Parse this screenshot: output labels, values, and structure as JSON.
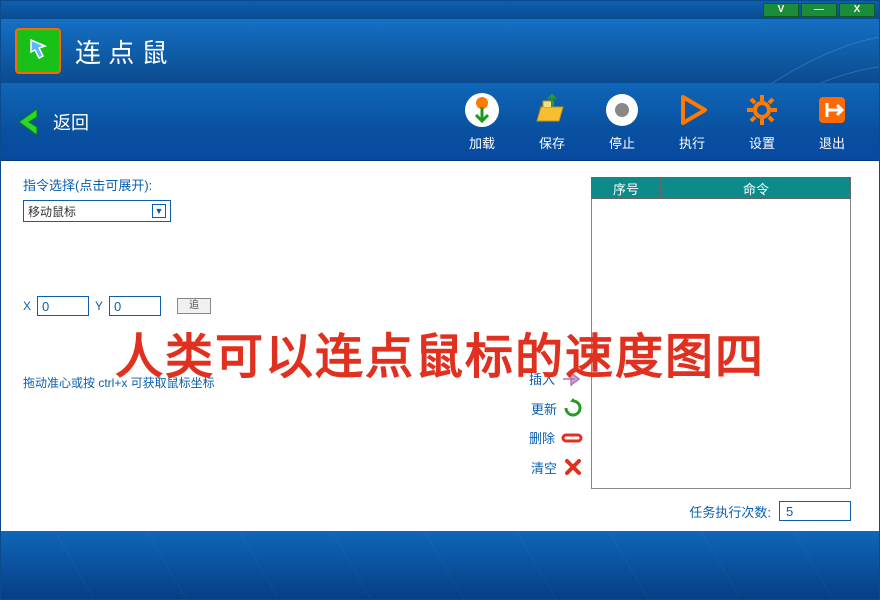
{
  "app": {
    "title": "连 点 鼠"
  },
  "window_controls": {
    "v": "V",
    "min": "—",
    "close": "X"
  },
  "back": {
    "label": "返回"
  },
  "toolbar": {
    "load": "加载",
    "save": "保存",
    "stop": "停止",
    "run": "执行",
    "settings": "设置",
    "exit": "退出"
  },
  "left": {
    "section_label": "指令选择(点击可展开):",
    "combo_value": "移动鼠标",
    "x_label": "X",
    "y_label": "Y",
    "x_value": "0",
    "y_value": "0",
    "track_btn": "追",
    "hint": "拖动准心或按 ctrl+x 可获取鼠标坐标"
  },
  "grid": {
    "col_seq": "序号",
    "col_cmd": "命令"
  },
  "actions": {
    "insert": "插入",
    "update": "更新",
    "delete": "删除",
    "clear": "清空"
  },
  "exec": {
    "label": "任务执行次数:",
    "value": "5"
  },
  "overlay": "人类可以连点鼠标的速度图四"
}
